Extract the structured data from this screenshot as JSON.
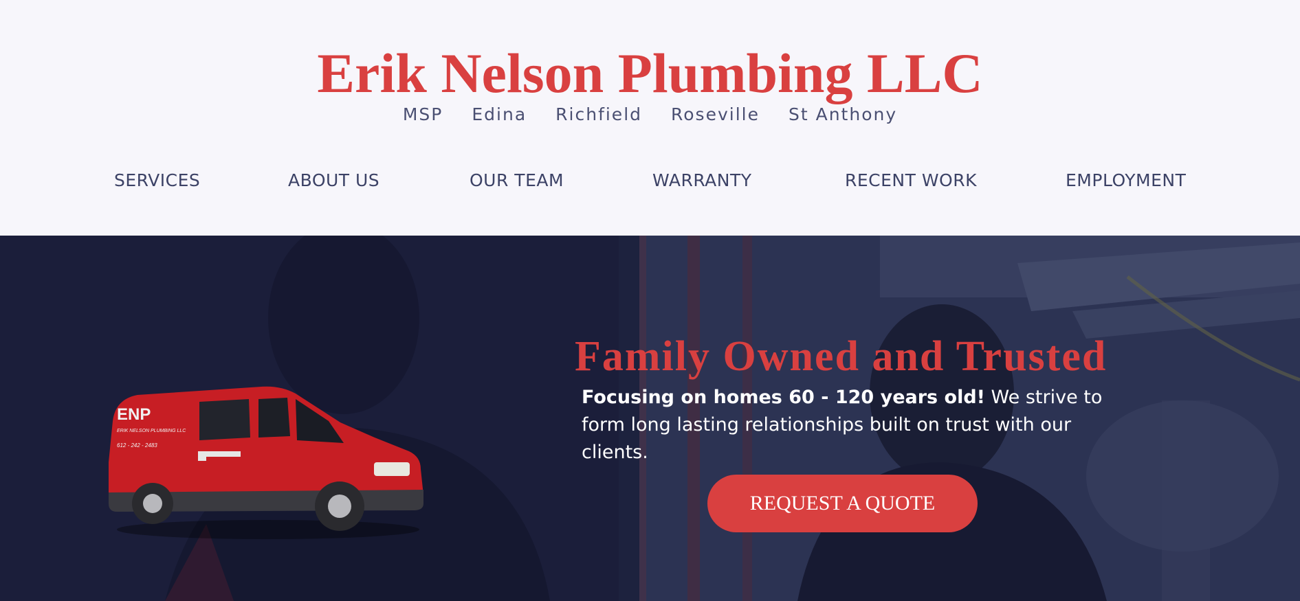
{
  "site": {
    "title": "Erik Nelson Plumbing LLC",
    "locations": [
      "MSP",
      "Edina",
      "Richfield",
      "Roseville",
      "St Anthony"
    ]
  },
  "nav": {
    "items": [
      "SERVICES",
      "ABOUT US",
      "OUR TEAM",
      "WARRANTY",
      "RECENT WORK",
      "EMPLOYMENT"
    ]
  },
  "hero": {
    "title": "Family Owned and Trusted",
    "text_bold": "Focusing on homes 60 - 120 years old!",
    "text_rest": " We strive to form long lasting relationships built on trust with our clients.",
    "cta": "REQUEST A QUOTE",
    "van_logo": "ENP",
    "van_company": "ERIK NELSON PLUMBING LLC",
    "van_phone": "612 - 242 - 2483"
  },
  "colors": {
    "accent": "#d94040",
    "nav_text": "#3c4266",
    "header_bg": "#f7f6fb",
    "hero_dark": "#202443"
  }
}
